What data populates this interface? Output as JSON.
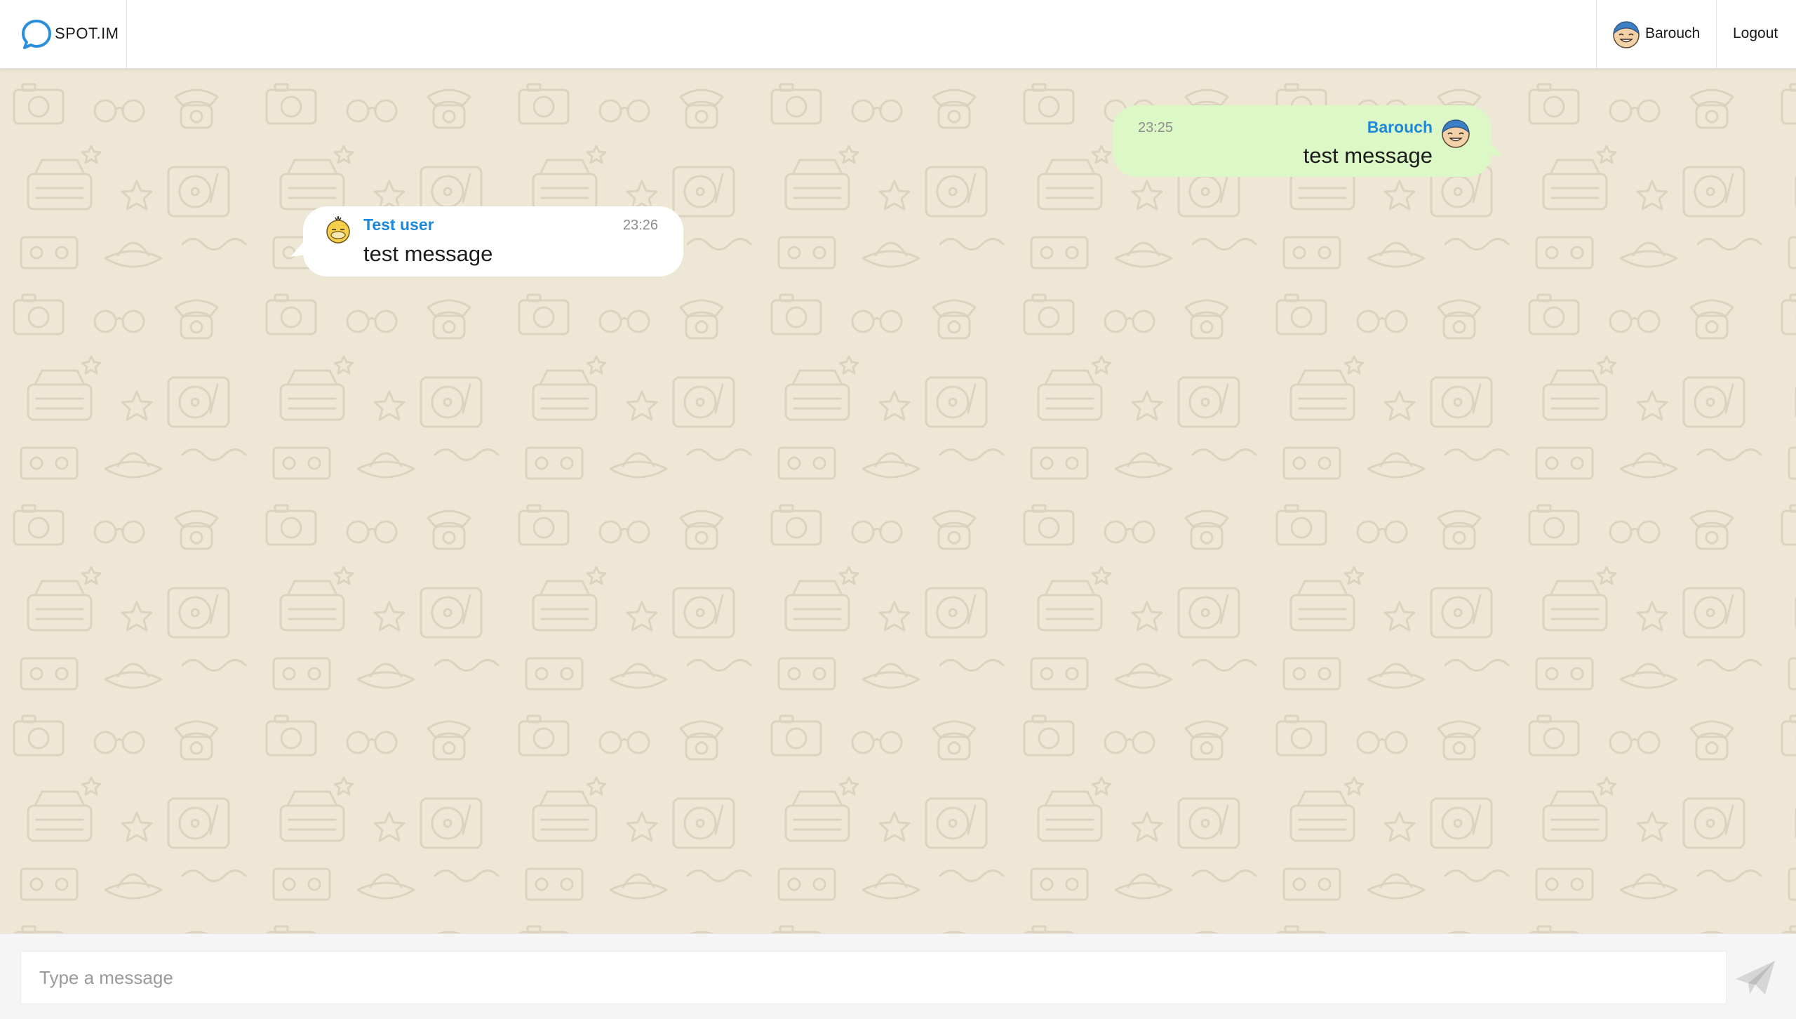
{
  "header": {
    "brand_name": "SPOT.IM",
    "user_name": "Barouch",
    "logout_label": "Logout"
  },
  "messages": [
    {
      "direction": "outgoing",
      "author": "Barouch",
      "time": "23:25",
      "text": "test message",
      "avatar_icon": "smiling-face-avatar-icon"
    },
    {
      "direction": "incoming",
      "author": "Test user",
      "time": "23:26",
      "text": "test message",
      "avatar_icon": "duck-face-avatar-icon"
    }
  ],
  "composer": {
    "placeholder": "Type a message",
    "value": "",
    "send_icon": "paper-plane-icon"
  },
  "colors": {
    "accent": "#1e88d8",
    "outgoing_bubble": "#dcf8c6",
    "incoming_bubble": "#ffffff",
    "chat_background": "#efe7d6"
  }
}
